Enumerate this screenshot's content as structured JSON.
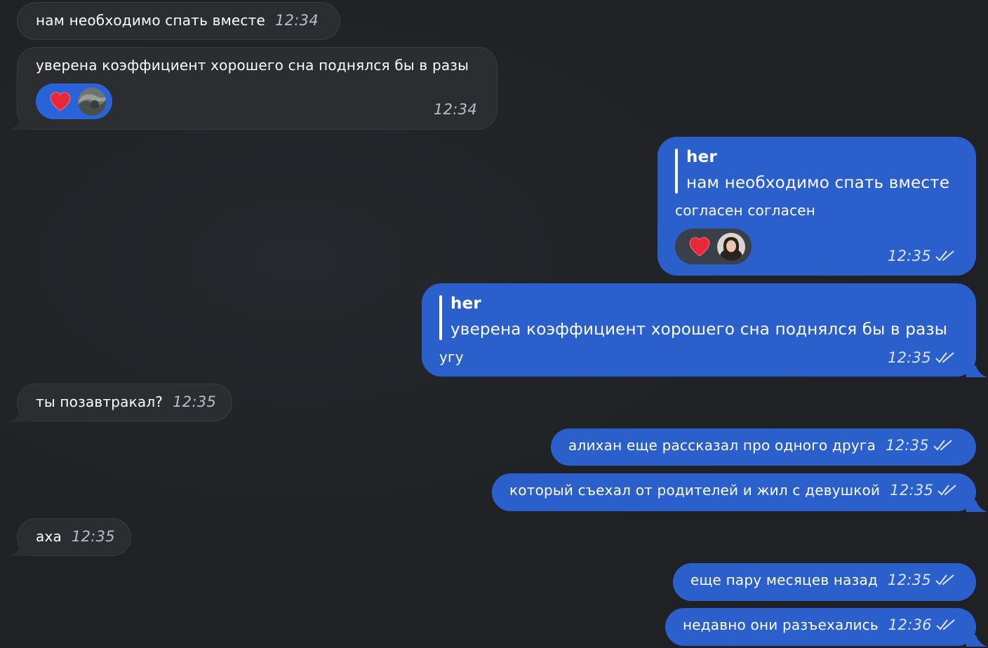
{
  "messages": {
    "m1": {
      "text": "нам необходимо спать вместе",
      "time": "12:34"
    },
    "m2": {
      "text": "уверена коэффициент хорошего сна поднялся бы в разы",
      "time": "12:34"
    },
    "m3": {
      "reply_author": "her",
      "reply_text": "нам необходимо спать вместе",
      "text": "согласен согласен",
      "time": "12:35"
    },
    "m4": {
      "reply_author": "her",
      "reply_text": "уверена коэффициент хорошего сна поднялся бы в разы",
      "text": "угу",
      "time": "12:35"
    },
    "m5": {
      "text": "ты позавтракал?",
      "time": "12:35"
    },
    "m6": {
      "text": "алихан еще рассказал про одного друга",
      "time": "12:35"
    },
    "m7": {
      "text": "который съехал от родителей и жил с девушкой",
      "time": "12:35"
    },
    "m8": {
      "text": "аха",
      "time": "12:35"
    },
    "m9": {
      "text": "еще пару месяцев назад",
      "time": "12:35"
    },
    "m10": {
      "text": "недавно они разъехались",
      "time": "12:36"
    }
  },
  "icons": {
    "reaction": "heart-icon",
    "read_status": "double-check-icon"
  },
  "colors": {
    "incoming_bubble": "#2b2d31",
    "outgoing_bubble": "#2b5fcb",
    "background": "#1f2124",
    "reaction_active": "#2a63d8"
  }
}
